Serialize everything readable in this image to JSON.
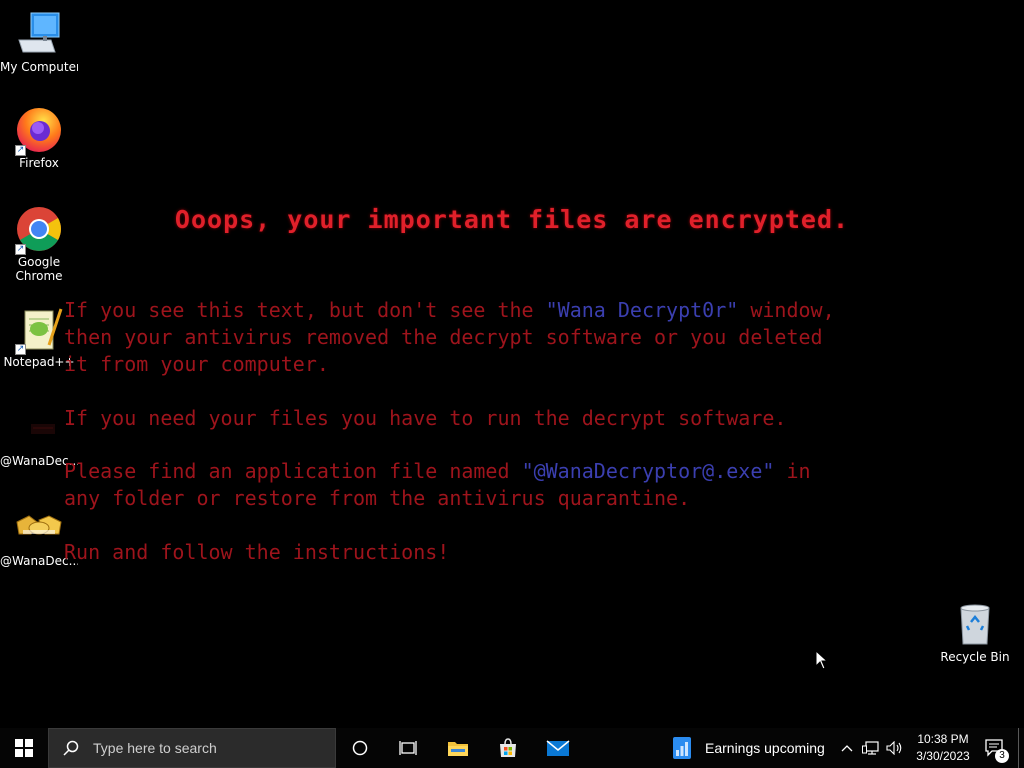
{
  "desktop": {
    "icons": [
      {
        "label": "My Computer",
        "icon": "computer-icon"
      },
      {
        "label": "Firefox",
        "icon": "firefox-icon"
      },
      {
        "label": "Google Chrome",
        "icon": "chrome-icon"
      },
      {
        "label": "Notepad++",
        "icon": "notepadpp-icon"
      },
      {
        "label": "@WanaDec...",
        "icon": "wanadecryptor-icon"
      },
      {
        "label": "@WanaDec...",
        "icon": "handshake-icon"
      },
      {
        "label": "Recycle Bin",
        "icon": "recycle-bin-icon"
      }
    ]
  },
  "ransom_note": {
    "title": "Ooops, your important files are encrypted.",
    "p1_line1_a": "If you see this text, but don't see the ",
    "p1_line1_hl": "\"Wana Decrypt0r\"",
    "p1_line1_b": " window,",
    "p1_line2": "then your antivirus removed the decrypt software or you deleted",
    "p1_line3": "it from your computer.",
    "p2": "If you need your files you have to run the decrypt software.",
    "p3_line1_a": "Please find an application file named ",
    "p3_line1_hl": "\"@WanaDecryptor@.exe\"",
    "p3_line1_b": " in",
    "p3_line2": "any folder or restore from the antivirus quarantine.",
    "p4": "Run and follow the instructions!"
  },
  "taskbar": {
    "search_placeholder": "Type here to search",
    "news_widget": "Earnings upcoming",
    "time": "10:38 PM",
    "date": "3/30/2023",
    "notification_count": "3"
  },
  "colors": {
    "title_red": "#e0202a",
    "body_red": "#9e141c",
    "highlight_blue": "#3b3fb0"
  }
}
